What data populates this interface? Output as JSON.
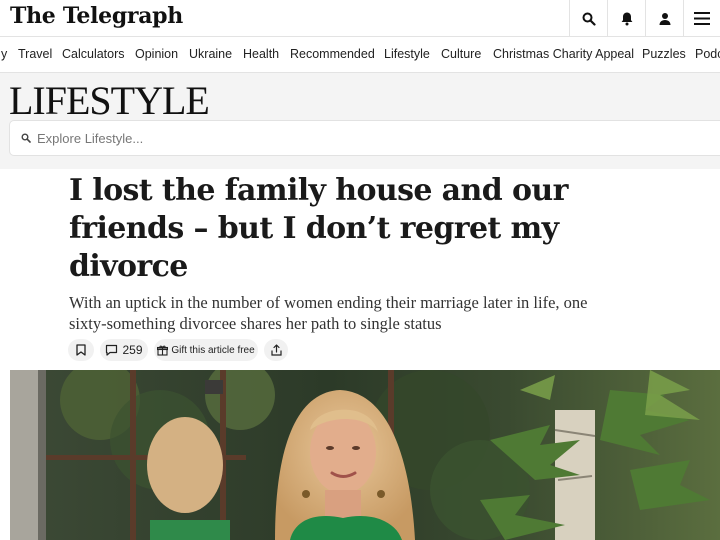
{
  "header": {
    "logo": "The Telegraph",
    "buttons": [
      {
        "icon": "search-icon"
      },
      {
        "icon": "bell-icon"
      },
      {
        "icon": "account-icon"
      },
      {
        "icon": "menu-icon"
      }
    ]
  },
  "nav": {
    "items": [
      "y",
      "Travel",
      "Calculators",
      "Opinion",
      "Ukraine",
      "Health",
      "Recommended",
      "Lifestyle",
      "Culture",
      "Christmas Charity Appeal",
      "Puzzles",
      "Podc"
    ]
  },
  "section": {
    "title": "LIFESTYLE",
    "search_placeholder": "Explore Lifestyle..."
  },
  "article": {
    "headline": "I lost the family house and our friends – but I don’t regret my divorce",
    "standfirst": "With an uptick in the number of women ending their marriage later in life, one sixty-something divorcee shares her path to single status",
    "comment_count": "259",
    "gift_label": "Gift this article free"
  },
  "colors": {
    "band_background": "#f4f4f4",
    "button_background": "#f1f1f1",
    "text": "#1a1a1a"
  }
}
